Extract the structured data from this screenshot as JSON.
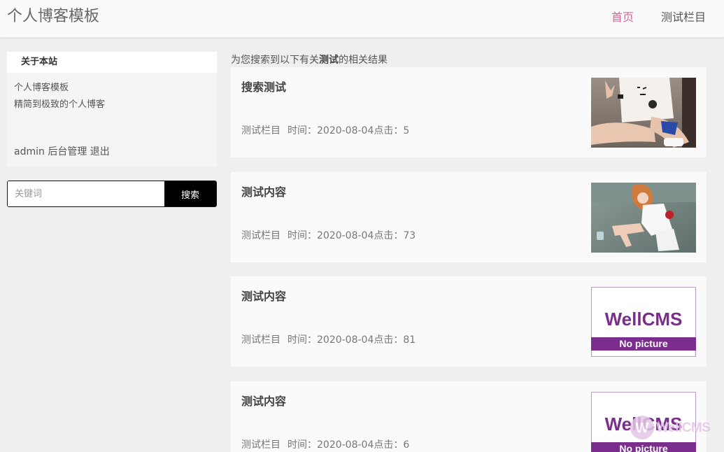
{
  "header": {
    "site_title": "个人博客模板",
    "nav": [
      {
        "label": "首页",
        "active": true
      },
      {
        "label": "测试栏目",
        "active": false
      }
    ]
  },
  "sidebar": {
    "about": {
      "heading": "关于本站",
      "line1": "个人博客模板",
      "line2": "精简到极致的个人博客",
      "user": "admin",
      "admin_link": "后台管理",
      "logout_link": "退出"
    },
    "search": {
      "placeholder": "关键词",
      "value": "",
      "button_label": "搜索"
    }
  },
  "results": {
    "prefix": "为您搜索到以下有关",
    "keyword": "测试",
    "suffix": "的相关结果",
    "items": [
      {
        "title": "搜索测试",
        "category": "测试栏目",
        "time_label": "时间：",
        "date": "2020-08-04",
        "clicks_label": "点击：",
        "clicks": "5",
        "thumb": "photo-girl-sitting"
      },
      {
        "title": "测试内容",
        "category": "测试栏目",
        "time_label": "时间：",
        "date": "2020-08-04",
        "clicks_label": "点击：",
        "clicks": "73",
        "thumb": "photo-girl-ground"
      },
      {
        "title": "测试内容",
        "category": "测试栏目",
        "time_label": "时间：",
        "date": "2020-08-04",
        "clicks_label": "点击：",
        "clicks": "81",
        "thumb": "no-picture"
      },
      {
        "title": "测试内容",
        "category": "测试栏目",
        "time_label": "时间：",
        "date": "2020-08-04",
        "clicks_label": "点击：",
        "clicks": "6",
        "thumb": "no-picture"
      }
    ],
    "placeholder_image": {
      "brand": "WellCMS",
      "caption": "No picture"
    }
  },
  "watermark": {
    "text": "WellCMS"
  },
  "colors": {
    "accent": "#e0619a",
    "brand_purple": "#7b2d8e"
  }
}
